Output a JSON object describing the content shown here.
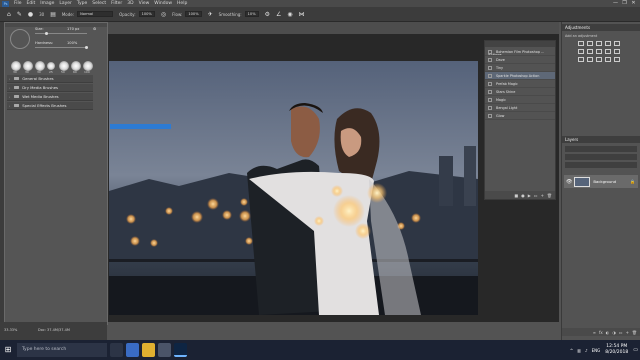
{
  "menubar": {
    "app_icon": "Ps",
    "items": [
      "File",
      "Edit",
      "Image",
      "Layer",
      "Type",
      "Select",
      "Filter",
      "3D",
      "View",
      "Window",
      "Help"
    ],
    "window_controls": [
      "—",
      "❐",
      "✕"
    ]
  },
  "options_bar": {
    "mode_label": "Mode:",
    "mode_value": "Normal",
    "opacity_label": "Opacity:",
    "opacity_value": "100%",
    "flow_label": "Flow:",
    "flow_value": "100%",
    "smoothing_label": "Smoothing:",
    "smoothing_value": "10%",
    "brush_size": "30"
  },
  "brush_panel": {
    "size_label": "Size:",
    "size_value": "170 px",
    "hardness_label": "Hardness:",
    "hardness_value": "100%",
    "angle_value": "0°",
    "presets": [
      "30",
      "30",
      "30",
      "25",
      "50",
      "60",
      "100"
    ],
    "folders": [
      "General Brushes",
      "Dry Media Brushes",
      "Wet Media Brushes",
      "Special Effects Brushes"
    ]
  },
  "actions_panel": {
    "title": "Actions",
    "rows": [
      {
        "label": "Bohemian Film Photoshop ...",
        "selected": false
      },
      {
        "label": "Dave",
        "selected": false
      },
      {
        "label": "Tiny",
        "selected": false
      },
      {
        "label": "Sparkle Photoshop Action",
        "selected": true
      },
      {
        "label": "Prefab Magic",
        "selected": false
      },
      {
        "label": "Stars Shine",
        "selected": false
      },
      {
        "label": "Magic",
        "selected": false
      },
      {
        "label": "Bengal Light",
        "selected": false
      },
      {
        "label": "Glow",
        "selected": false
      }
    ]
  },
  "right_panel": {
    "adjustments_title": "Adjustments",
    "add_adjustment_label": "Add an adjustment",
    "layers_title": "Layers",
    "layer_name": "Background"
  },
  "status_bar": {
    "zoom": "33.33%",
    "doc_info": "Doc: 37.4M/37.4M"
  },
  "taskbar": {
    "search_placeholder": "Type here to search",
    "language": "ENG",
    "time": "12:54 PM",
    "date": "8/20/2018"
  }
}
